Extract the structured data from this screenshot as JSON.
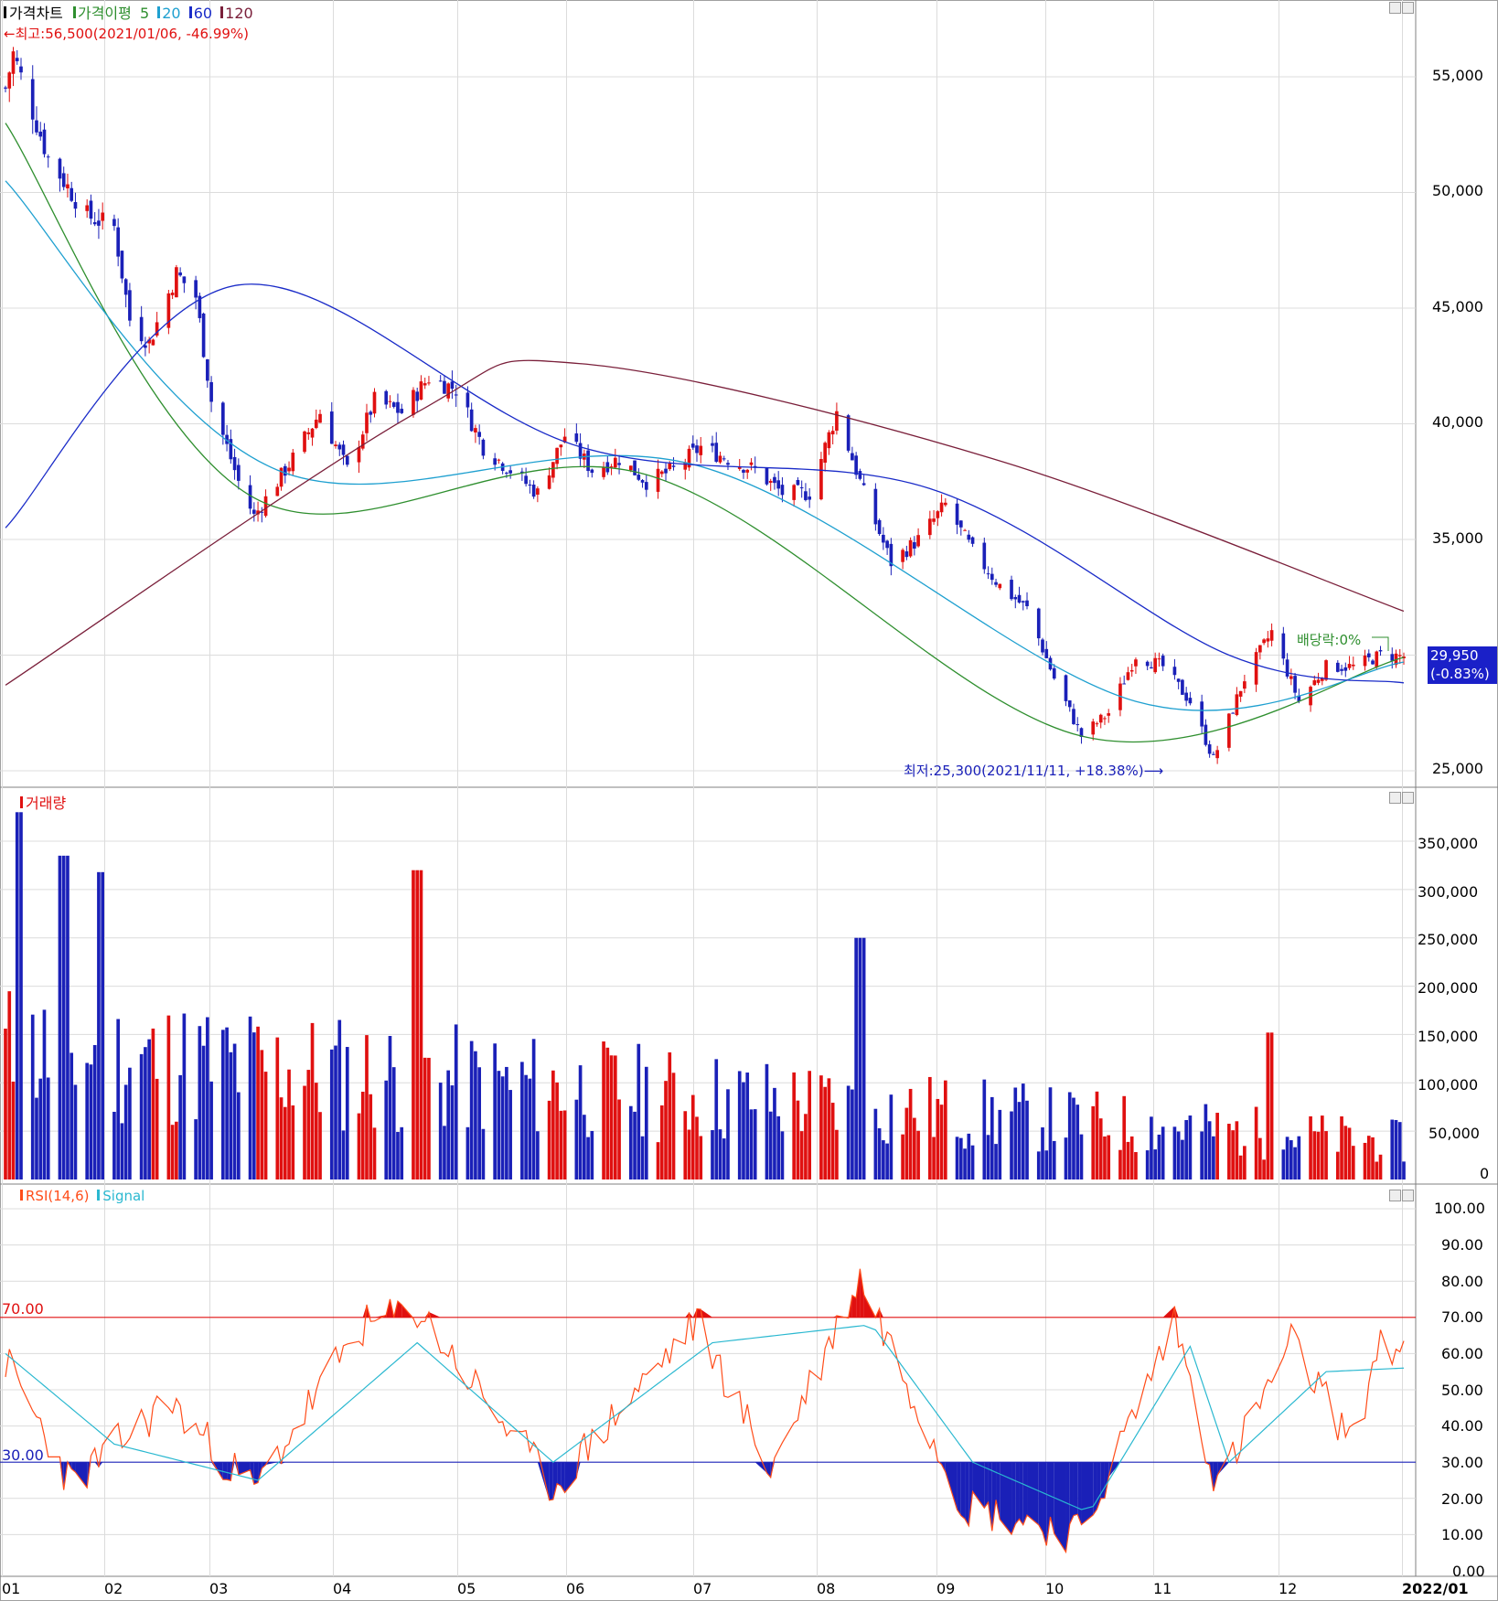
{
  "price_panel": {
    "legend": [
      {
        "label": "가격차트",
        "color": "#000000"
      },
      {
        "label": "가격이평",
        "color": "#2f8f2f"
      },
      {
        "label": "5",
        "color": "#2f8f2f"
      },
      {
        "label": "20",
        "color": "#1fa0d0"
      },
      {
        "label": "60",
        "color": "#1a2bc8"
      },
      {
        "label": "120",
        "color": "#7a1f3a"
      }
    ],
    "high_annotation": "←최고:56,500(2021/01/06, -46.99%)",
    "low_annotation": "최저:25,300(2021/11/11, +18.38%)⟶",
    "dividend_annotation": "배당락:0%",
    "last_price": "29,950",
    "last_change": "(-0.83%)",
    "y_ticks": [
      "55,000",
      "50,000",
      "45,000",
      "40,000",
      "35,000",
      "25,000"
    ]
  },
  "volume_panel": {
    "title": "거래량",
    "y_ticks": [
      "350,000",
      "300,000",
      "250,000",
      "200,000",
      "150,000",
      "100,000",
      "50,000",
      "0"
    ]
  },
  "rsi_panel": {
    "legend": [
      {
        "label": "RSI(14,6)",
        "color": "#ff4d1a"
      },
      {
        "label": "Signal",
        "color": "#2ab8d0"
      }
    ],
    "upper_line_label": "70.00",
    "lower_line_label": "30.00",
    "y_ticks": [
      "100.00",
      "90.00",
      "80.00",
      "70.00",
      "60.00",
      "50.00",
      "40.00",
      "30.00",
      "20.00",
      "10.00",
      "0.00"
    ]
  },
  "x_axis": {
    "labels": [
      "01",
      "02",
      "03",
      "04",
      "05",
      "06",
      "07",
      "08",
      "09",
      "10",
      "11",
      "12",
      "2022/01"
    ]
  },
  "colors": {
    "up": "#e01010",
    "down": "#1a20b8",
    "ma5": "#2f8f2f",
    "ma20": "#1fa0d0",
    "ma60": "#1a2bc8",
    "ma120": "#7a1f3a",
    "rsi": "#ff4d1a",
    "signal": "#2ab8d0",
    "grid": "#dcdcdc"
  },
  "chart_data": [
    {
      "type": "candlestick",
      "title": "가격차트",
      "x_range": [
        "2021/01",
        "2022/01"
      ],
      "ylim": [
        25000,
        57000
      ],
      "high": {
        "value": 56500,
        "date": "2021/01/06",
        "change_to_last": "-46.99%"
      },
      "low": {
        "value": 25300,
        "date": "2021/11/11",
        "change_to_last": "+18.38%"
      },
      "last": {
        "value": 29950,
        "change": "-0.83%"
      },
      "close_path": [
        {
          "x": "2021-01-04",
          "y": 54500
        },
        {
          "x": "2021-01-06",
          "y": 56000
        },
        {
          "x": "2021-01-15",
          "y": 51500
        },
        {
          "x": "2021-01-25",
          "y": 49000
        },
        {
          "x": "2021-02-01",
          "y": 48500
        },
        {
          "x": "2021-02-05",
          "y": 44500
        },
        {
          "x": "2021-02-10",
          "y": 43500
        },
        {
          "x": "2021-02-17",
          "y": 46500
        },
        {
          "x": "2021-02-22",
          "y": 45500
        },
        {
          "x": "2021-02-26",
          "y": 41000
        },
        {
          "x": "2021-03-05",
          "y": 37500
        },
        {
          "x": "2021-03-09",
          "y": 36000
        },
        {
          "x": "2021-03-19",
          "y": 38500
        },
        {
          "x": "2021-03-26",
          "y": 40500
        },
        {
          "x": "2021-04-02",
          "y": 38000
        },
        {
          "x": "2021-04-09",
          "y": 41000
        },
        {
          "x": "2021-04-16",
          "y": 40500
        },
        {
          "x": "2021-04-23",
          "y": 42000
        },
        {
          "x": "2021-04-30",
          "y": 41500
        },
        {
          "x": "2021-05-07",
          "y": 39000
        },
        {
          "x": "2021-05-14",
          "y": 38000
        },
        {
          "x": "2021-05-21",
          "y": 37000
        },
        {
          "x": "2021-05-28",
          "y": 39500
        },
        {
          "x": "2021-06-04",
          "y": 38000
        },
        {
          "x": "2021-06-11",
          "y": 38500
        },
        {
          "x": "2021-06-18",
          "y": 37500
        },
        {
          "x": "2021-06-25",
          "y": 38000
        },
        {
          "x": "2021-07-02",
          "y": 39000
        },
        {
          "x": "2021-07-09",
          "y": 38500
        },
        {
          "x": "2021-07-16",
          "y": 38000
        },
        {
          "x": "2021-07-23",
          "y": 37000
        },
        {
          "x": "2021-07-30",
          "y": 37000
        },
        {
          "x": "2021-08-06",
          "y": 40500
        },
        {
          "x": "2021-08-13",
          "y": 37000
        },
        {
          "x": "2021-08-20",
          "y": 34000
        },
        {
          "x": "2021-08-27",
          "y": 35000
        },
        {
          "x": "2021-09-03",
          "y": 36500
        },
        {
          "x": "2021-09-10",
          "y": 34500
        },
        {
          "x": "2021-09-17",
          "y": 33000
        },
        {
          "x": "2021-09-24",
          "y": 32000
        },
        {
          "x": "2021-10-01",
          "y": 29000
        },
        {
          "x": "2021-10-08",
          "y": 26500
        },
        {
          "x": "2021-10-15",
          "y": 27500
        },
        {
          "x": "2021-10-22",
          "y": 30000
        },
        {
          "x": "2021-10-29",
          "y": 29500
        },
        {
          "x": "2021-11-05",
          "y": 28000
        },
        {
          "x": "2021-11-11",
          "y": 25500
        },
        {
          "x": "2021-11-19",
          "y": 29000
        },
        {
          "x": "2021-11-26",
          "y": 31000
        },
        {
          "x": "2021-12-03",
          "y": 28000
        },
        {
          "x": "2021-12-10",
          "y": 29500
        },
        {
          "x": "2021-12-17",
          "y": 29500
        },
        {
          "x": "2021-12-24",
          "y": 30000
        },
        {
          "x": "2021-12-30",
          "y": 29950
        }
      ],
      "moving_averages": [
        {
          "period": 5,
          "values": [
            {
              "x": "2021-01-04",
              "y": 53000
            },
            {
              "x": "2021-03-09",
              "y": 36800
            },
            {
              "x": "2021-06-18",
              "y": 37800
            },
            {
              "x": "2021-10-08",
              "y": 26500
            },
            {
              "x": "2021-12-30",
              "y": 29900
            }
          ]
        },
        {
          "period": 20,
          "values": [
            {
              "x": "2021-01-04",
              "y": 50500
            },
            {
              "x": "2021-03-15",
              "y": 38000
            },
            {
              "x": "2021-07-01",
              "y": 38200
            },
            {
              "x": "2021-10-22",
              "y": 28000
            },
            {
              "x": "2021-12-30",
              "y": 29700
            }
          ]
        },
        {
          "period": 60,
          "values": [
            {
              "x": "2021-01-04",
              "y": 35500
            },
            {
              "x": "2021-03-05",
              "y": 46000
            },
            {
              "x": "2021-06-01",
              "y": 39000
            },
            {
              "x": "2021-08-30",
              "y": 37200
            },
            {
              "x": "2021-11-15",
              "y": 30000
            },
            {
              "x": "2021-12-30",
              "y": 28800
            }
          ]
        },
        {
          "period": 120,
          "values": [
            {
              "x": "2021-01-04",
              "y": 28700
            },
            {
              "x": "2021-04-20",
              "y": 40500
            },
            {
              "x": "2021-06-01",
              "y": 42600
            },
            {
              "x": "2021-09-15",
              "y": 38500
            },
            {
              "x": "2021-12-30",
              "y": 31900
            }
          ]
        }
      ]
    },
    {
      "type": "bar",
      "title": "거래량",
      "ylim": [
        0,
        390000
      ],
      "values_note_free": true,
      "peaks": [
        {
          "x": "2021-01-08",
          "y": 380000
        },
        {
          "x": "2021-01-19",
          "y": 335000
        },
        {
          "x": "2021-01-29",
          "y": 318000
        },
        {
          "x": "2021-04-20",
          "y": 320000
        },
        {
          "x": "2021-08-12",
          "y": 250000
        },
        {
          "x": "2021-11-26",
          "y": 152000
        }
      ]
    },
    {
      "type": "line",
      "title": "RSI(14,6)",
      "ylim": [
        0,
        100
      ],
      "reference_lines": [
        70,
        30
      ],
      "series": [
        {
          "name": "RSI(14,6)",
          "values": [
            {
              "x": "2021-01-04",
              "y": 58
            },
            {
              "x": "2021-01-21",
              "y": 24
            },
            {
              "x": "2021-02-15",
              "y": 47
            },
            {
              "x": "2021-03-09",
              "y": 22
            },
            {
              "x": "2021-04-05",
              "y": 67
            },
            {
              "x": "2021-04-20",
              "y": 72
            },
            {
              "x": "2021-05-25",
              "y": 23
            },
            {
              "x": "2021-07-01",
              "y": 69
            },
            {
              "x": "2021-07-20",
              "y": 28
            },
            {
              "x": "2021-08-12",
              "y": 81
            },
            {
              "x": "2021-09-08",
              "y": 18
            },
            {
              "x": "2021-10-08",
              "y": 10
            },
            {
              "x": "2021-11-01",
              "y": 69
            },
            {
              "x": "2021-11-12",
              "y": 23
            },
            {
              "x": "2021-12-01",
              "y": 63
            },
            {
              "x": "2021-12-17",
              "y": 35
            },
            {
              "x": "2021-12-24",
              "y": 65
            },
            {
              "x": "2021-12-30",
              "y": 58
            }
          ]
        },
        {
          "name": "Signal",
          "values": [
            {
              "x": "2021-01-04",
              "y": 60
            },
            {
              "x": "2021-02-01",
              "y": 35
            },
            {
              "x": "2021-03-10",
              "y": 25
            },
            {
              "x": "2021-04-20",
              "y": 63
            },
            {
              "x": "2021-05-25",
              "y": 30
            },
            {
              "x": "2021-07-05",
              "y": 63
            },
            {
              "x": "2021-08-15",
              "y": 68
            },
            {
              "x": "2021-09-10",
              "y": 30
            },
            {
              "x": "2021-10-10",
              "y": 16
            },
            {
              "x": "2021-11-05",
              "y": 62
            },
            {
              "x": "2021-11-15",
              "y": 30
            },
            {
              "x": "2021-12-10",
              "y": 55
            },
            {
              "x": "2021-12-30",
              "y": 56
            }
          ]
        }
      ]
    }
  ]
}
